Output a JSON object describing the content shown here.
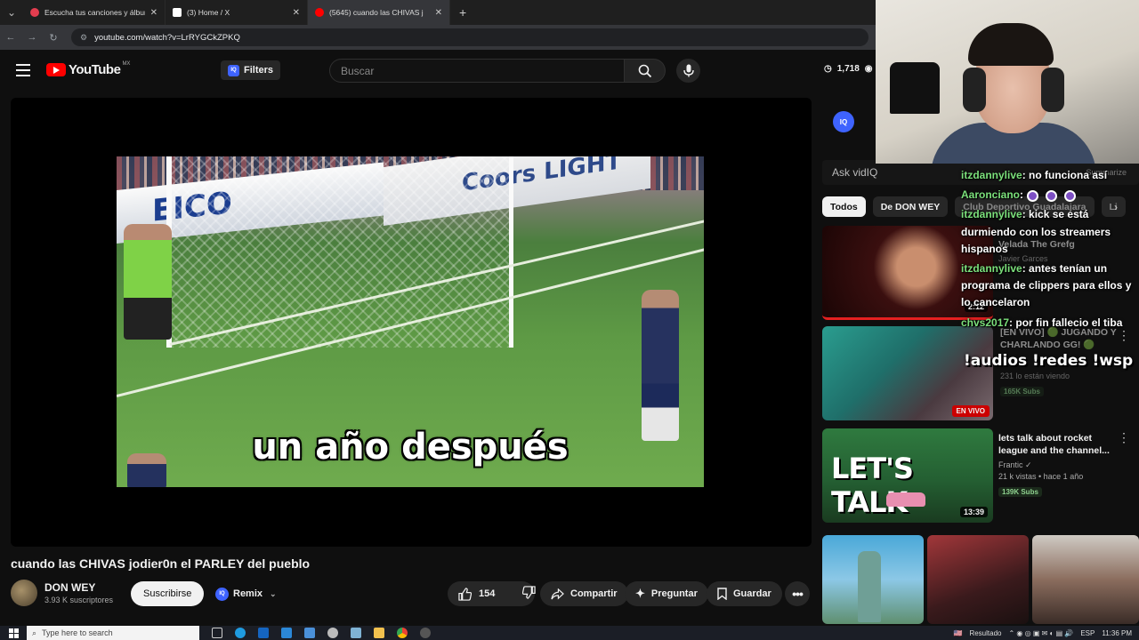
{
  "browser": {
    "tabs": [
      {
        "title": "Escucha tus canciones y álbume",
        "favicon_color": "#e33d4f"
      },
      {
        "title": "(3) Home / X",
        "favicon_color": "#ffffff"
      },
      {
        "title": "(5645) cuando las CHIVAS j",
        "favicon_color": "#ff0000"
      }
    ],
    "url": "youtube.com/watch?v=LrRYGCkZPKQ"
  },
  "header": {
    "logo": "YouTube",
    "country": "MX",
    "filters_label": "Filters",
    "search_placeholder": "Buscar",
    "stat_time": "1,718",
    "stat_views": "1"
  },
  "video": {
    "subtitle": "un año después",
    "title": "cuando las CHIVAS jodier0n el PARLEY del pueblo",
    "channel": "DON WEY",
    "subscribers": "3.93 K suscriptores",
    "subscribe_label": "Suscribirse",
    "remix_label": "Remix",
    "likes": "154",
    "share_label": "Compartir",
    "ask_label": "Preguntar",
    "save_label": "Guardar",
    "board_text_1": "EICO",
    "board_text_2": "Coors LIGHT"
  },
  "sidebar": {
    "ask_placeholder": "Ask vidIQ",
    "summarize_label": "Summarize",
    "chips": [
      "Todos",
      "De DON WEY",
      "Club Deportivo Guadalajara",
      "Li"
    ],
    "recs": [
      {
        "title": "Velada The Grefg",
        "meta": "Javier Garces",
        "duration": "2:12"
      },
      {
        "title": "[EN VIVO] 🟢 JUGANDO Y CHARLANDO GG! 🟢",
        "meta": "231 lo están viendo",
        "badge": "165K Subs",
        "live": "EN VIVO"
      },
      {
        "title": "lets talk about rocket league and the channel...",
        "meta_line1": "Frantic",
        "meta_line2": "21 k vistas • hace 1 año",
        "badge": "139K Subs",
        "duration": "13:39",
        "thumb_text": "LET'S TALK"
      }
    ]
  },
  "chat": [
    {
      "user": "itzdannylive",
      "text": ": no funciona así"
    },
    {
      "user": "Aaronciano",
      "text": ":",
      "emotes": 3
    },
    {
      "user": "itzdannylive",
      "text": ": kick se está durmiendo con los streamers hispanos"
    },
    {
      "user": "itzdannylive",
      "text": ": antes tenían un programa de clippers para ellos y lo cancelaron"
    },
    {
      "user": "chvs2017",
      "text": ": por fin fallecio el tiba"
    }
  ],
  "overlay_commands": "!audios !redes !wsp",
  "taskbar": {
    "search_placeholder": "Type here to search",
    "weather_label": "Resultado",
    "lang": "ESP",
    "time": "11:36 PM"
  }
}
